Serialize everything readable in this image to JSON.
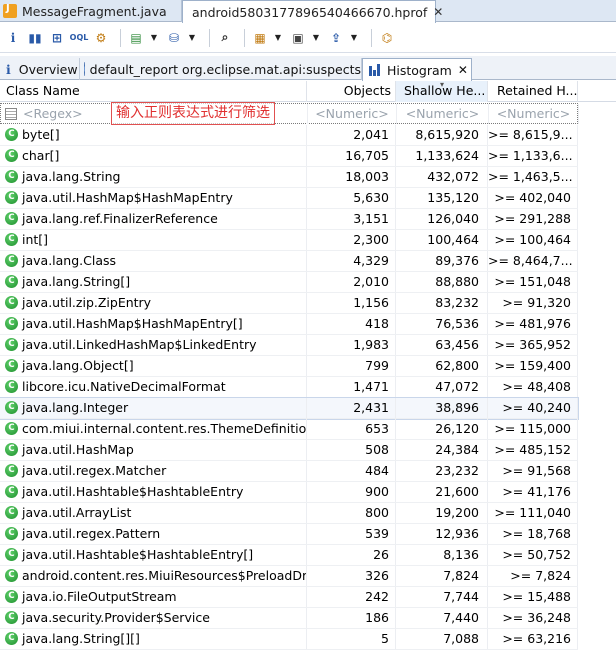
{
  "editor_tabs": [
    {
      "label": "MessageFragment.java"
    },
    {
      "label": "android5803177896540466670.hprof"
    }
  ],
  "view_tabs": [
    {
      "label": "Overview"
    },
    {
      "label": "default_report  org.eclipse.mat.api:suspects"
    },
    {
      "label": "Histogram"
    }
  ],
  "columns": {
    "class_name": "Class Name",
    "objects": "Objects",
    "shallow": "Shallow He...",
    "retained": "Retained H..."
  },
  "filter": {
    "regex": "<Regex>",
    "numeric1": "<Numeric>",
    "numeric2": "<Numeric>",
    "numeric3": "<Numeric>",
    "hint": "输入正则表达式进行筛选"
  },
  "rows": [
    {
      "name": "byte[]",
      "objects": "2,041",
      "shallow": "8,615,920",
      "retained": ">= 8,615,9..."
    },
    {
      "name": "char[]",
      "objects": "16,705",
      "shallow": "1,133,624",
      "retained": ">= 1,133,6..."
    },
    {
      "name": "java.lang.String",
      "objects": "18,003",
      "shallow": "432,072",
      "retained": ">= 1,463,5..."
    },
    {
      "name": "java.util.HashMap$HashMapEntry",
      "objects": "5,630",
      "shallow": "135,120",
      "retained": ">= 402,040"
    },
    {
      "name": "java.lang.ref.FinalizerReference",
      "objects": "3,151",
      "shallow": "126,040",
      "retained": ">= 291,288"
    },
    {
      "name": "int[]",
      "objects": "2,300",
      "shallow": "100,464",
      "retained": ">= 100,464"
    },
    {
      "name": "java.lang.Class",
      "objects": "4,329",
      "shallow": "89,376",
      "retained": ">= 8,464,7..."
    },
    {
      "name": "java.lang.String[]",
      "objects": "2,010",
      "shallow": "88,880",
      "retained": ">= 151,048"
    },
    {
      "name": "java.util.zip.ZipEntry",
      "objects": "1,156",
      "shallow": "83,232",
      "retained": ">= 91,320"
    },
    {
      "name": "java.util.HashMap$HashMapEntry[]",
      "objects": "418",
      "shallow": "76,536",
      "retained": ">= 481,976"
    },
    {
      "name": "java.util.LinkedHashMap$LinkedEntry",
      "objects": "1,983",
      "shallow": "63,456",
      "retained": ">= 365,952"
    },
    {
      "name": "java.lang.Object[]",
      "objects": "799",
      "shallow": "62,800",
      "retained": ">= 159,400"
    },
    {
      "name": "libcore.icu.NativeDecimalFormat",
      "objects": "1,471",
      "shallow": "47,072",
      "retained": ">= 48,408"
    },
    {
      "name": "java.lang.Integer",
      "objects": "2,431",
      "shallow": "38,896",
      "retained": ">= 40,240"
    },
    {
      "name": "com.miui.internal.content.res.ThemeDefinition$...",
      "objects": "653",
      "shallow": "26,120",
      "retained": ">= 115,000"
    },
    {
      "name": "java.util.HashMap",
      "objects": "508",
      "shallow": "24,384",
      "retained": ">= 485,152"
    },
    {
      "name": "java.util.regex.Matcher",
      "objects": "484",
      "shallow": "23,232",
      "retained": ">= 91,568"
    },
    {
      "name": "java.util.Hashtable$HashtableEntry",
      "objects": "900",
      "shallow": "21,600",
      "retained": ">= 41,176"
    },
    {
      "name": "java.util.ArrayList",
      "objects": "800",
      "shallow": "19,200",
      "retained": ">= 111,040"
    },
    {
      "name": "java.util.regex.Pattern",
      "objects": "539",
      "shallow": "12,936",
      "retained": ">= 18,768"
    },
    {
      "name": "java.util.Hashtable$HashtableEntry[]",
      "objects": "26",
      "shallow": "8,136",
      "retained": ">= 50,752"
    },
    {
      "name": "android.content.res.MiuiResources$PreloadDr...",
      "objects": "326",
      "shallow": "7,824",
      "retained": ">= 7,824"
    },
    {
      "name": "java.io.FileOutputStream",
      "objects": "242",
      "shallow": "7,744",
      "retained": ">= 15,488"
    },
    {
      "name": "java.security.Provider$Service",
      "objects": "186",
      "shallow": "7,440",
      "retained": ">= 36,248"
    },
    {
      "name": "java.lang.String[][]",
      "objects": "5",
      "shallow": "7,088",
      "retained": ">= 63,216"
    }
  ],
  "selected_row": 13,
  "colors": {
    "class_icon": "#1e8f2e",
    "hint": "#e03030",
    "accent": "#2a5aa8"
  }
}
